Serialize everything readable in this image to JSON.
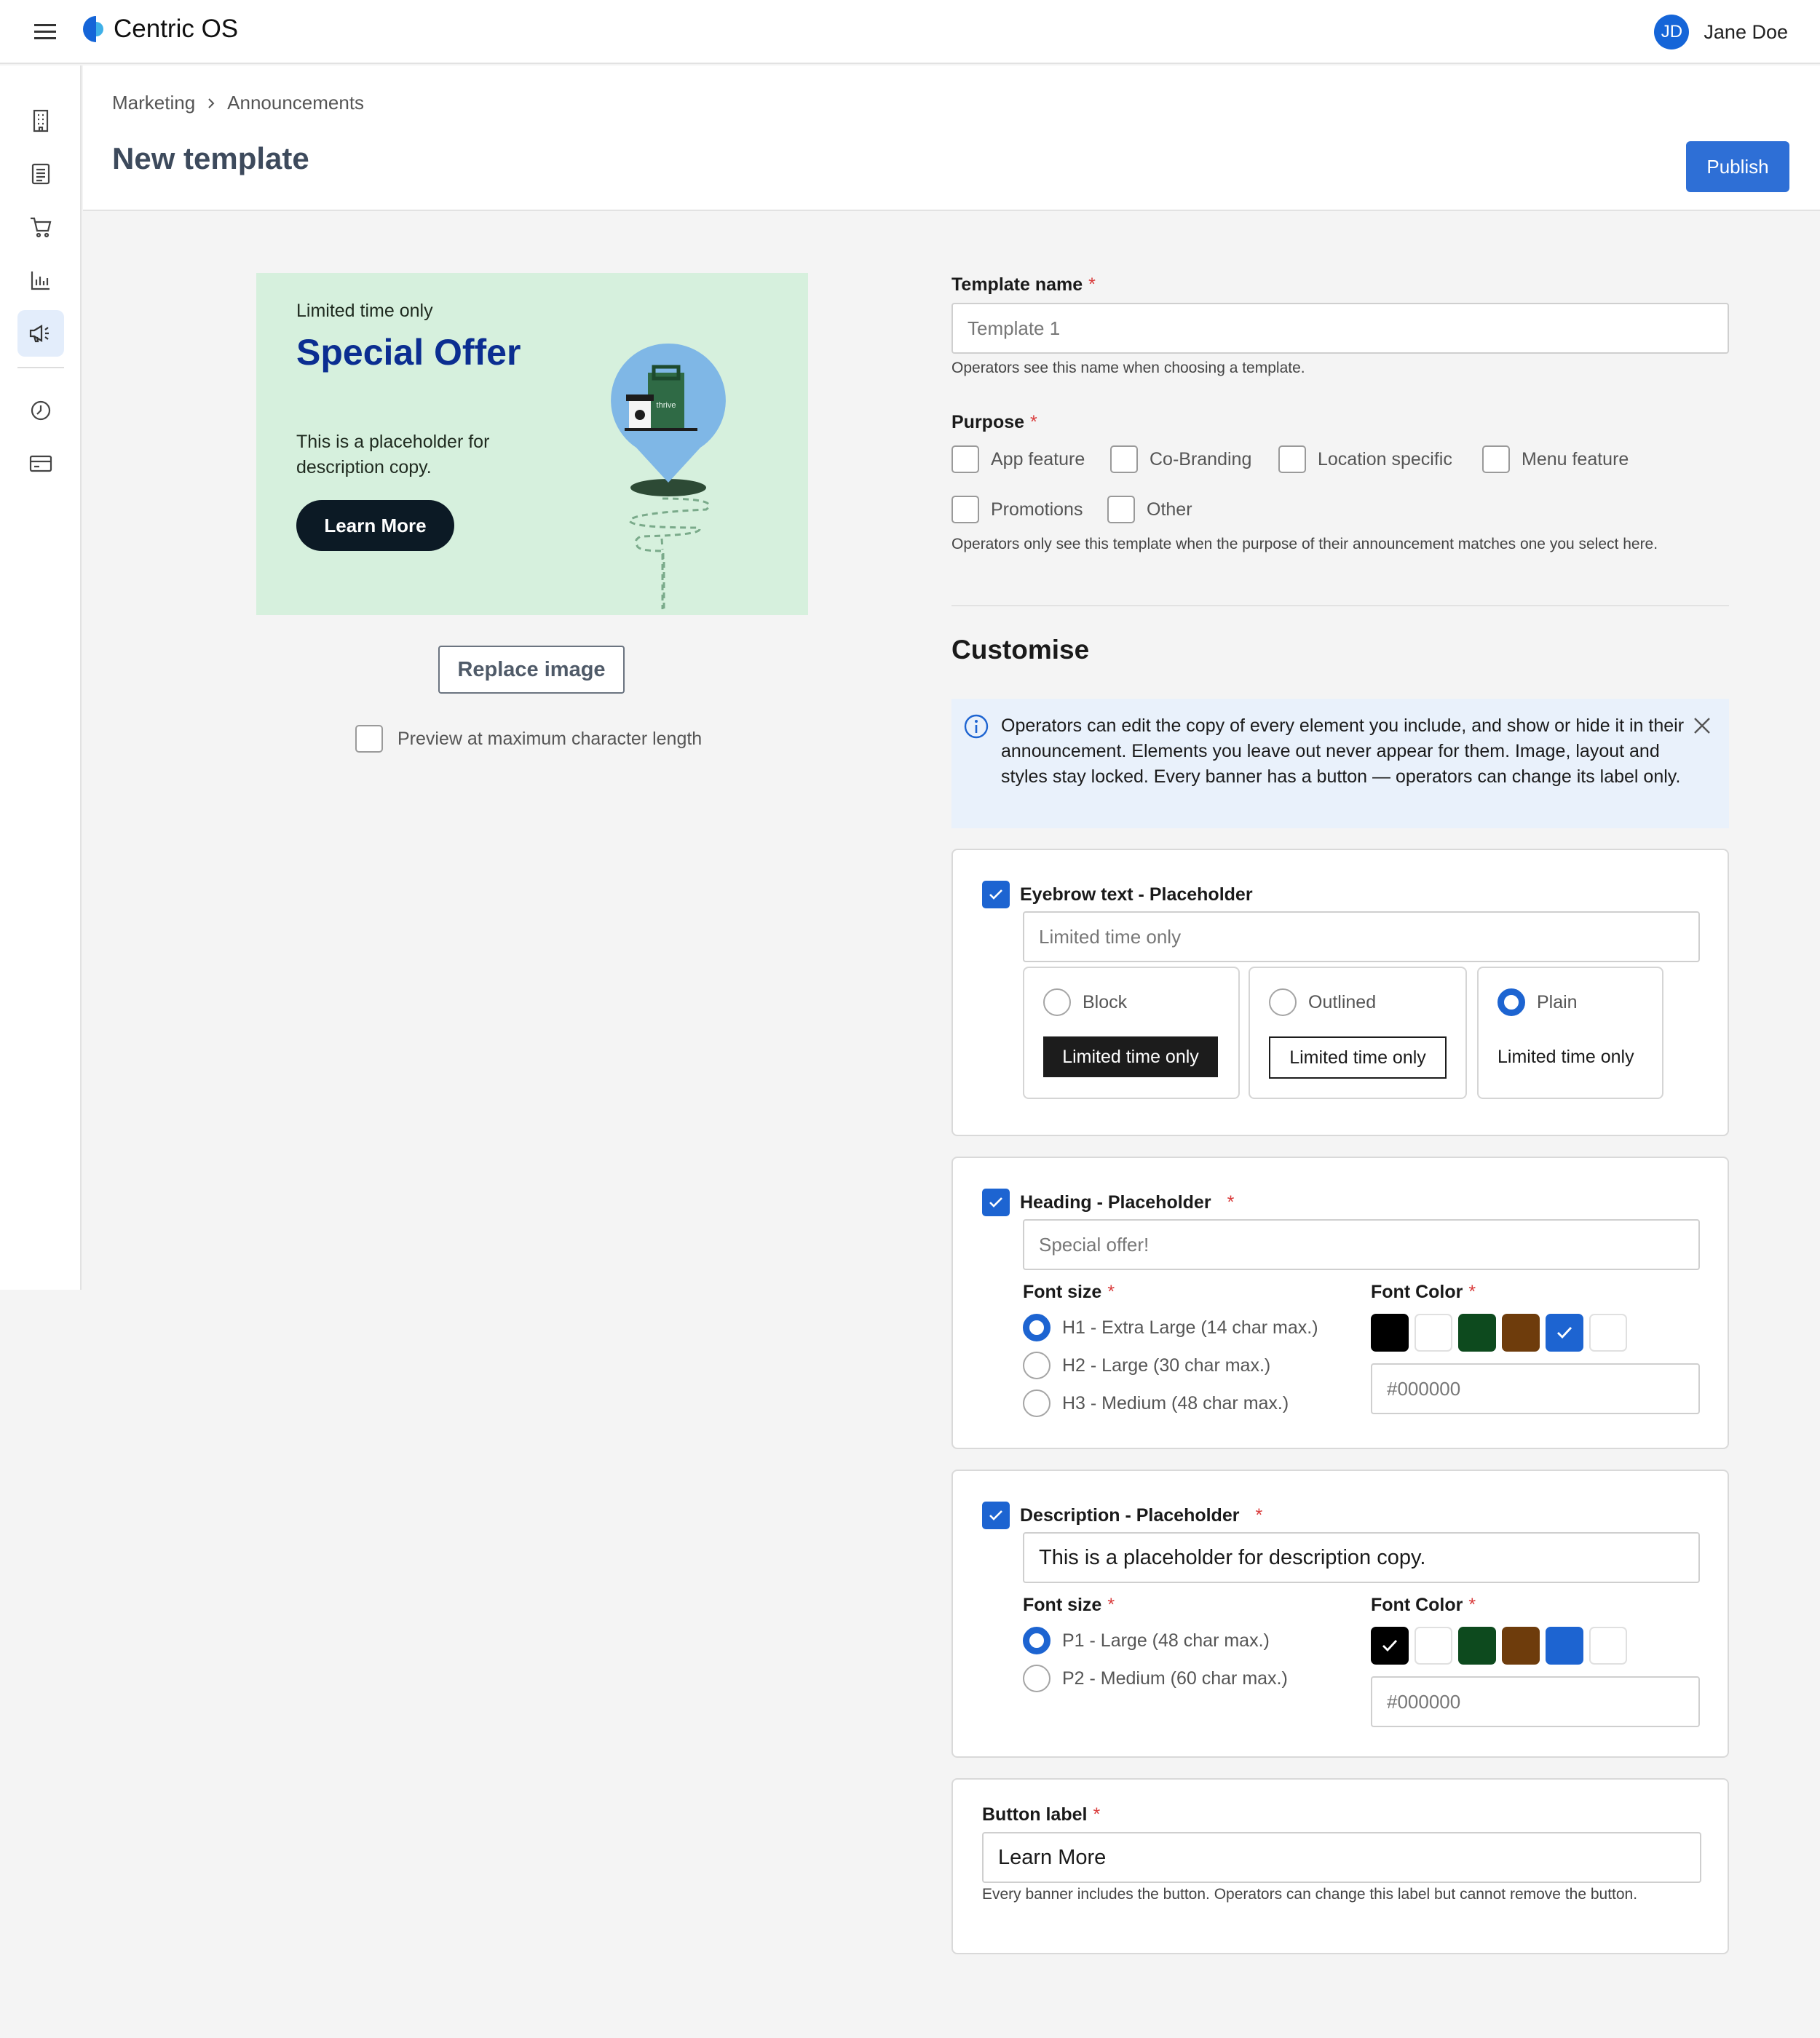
{
  "app": {
    "name": "Centric OS"
  },
  "user": {
    "initials": "JD",
    "name": "Jane Doe"
  },
  "breadcrumb": [
    "Marketing",
    "Announcements"
  ],
  "page": {
    "title": "New template",
    "publish_label": "Publish"
  },
  "preview": {
    "eyebrow": "Limited time only",
    "heading": "Special Offer",
    "description": "This is a placeholder for description copy.",
    "button": "Learn More",
    "art_label": "thrive",
    "replace_label": "Replace image",
    "max_length_label": "Preview at maximum character length",
    "bg_color": "#d6f0dd",
    "heading_color": "#0b2e91"
  },
  "form": {
    "template_name": {
      "label": "Template name",
      "placeholder": "Template 1",
      "help": "Operators see this name when choosing a template."
    },
    "purpose": {
      "label": "Purpose",
      "options": [
        "App feature",
        "Co-Branding",
        "Location specific",
        "Menu feature",
        "Promotions",
        "Other"
      ],
      "help": "Operators only see this template when the purpose of their announcement matches one you select here."
    },
    "customise_title": "Customise",
    "info": "Operators can edit the copy of every element you include, and show or hide it in their announcement. Elements you leave out never appear for them. Image, layout and styles stay locked. Every banner has a button — operators can change its label only.",
    "eyebrow": {
      "label": "Eyebrow text - Placeholder",
      "placeholder": "Limited time only",
      "styles": [
        {
          "name": "Block",
          "sample": "Limited time only"
        },
        {
          "name": "Outlined",
          "sample": "Limited time only"
        },
        {
          "name": "Plain",
          "sample": "Limited time only",
          "selected": true
        }
      ]
    },
    "heading": {
      "label": "Heading - Placeholder",
      "placeholder": "Special offer!",
      "font_size_label": "Font size",
      "sizes": [
        "H1 - Extra Large (14 char max.)",
        "H2 - Large (30 char max.)",
        "H3 - Medium (48 char max.)"
      ],
      "font_color_label": "Font Color",
      "color_value": "#000000"
    },
    "description": {
      "label": "Description - Placeholder",
      "value": "This is a placeholder for description copy.",
      "font_size_label": "Font size",
      "sizes": [
        "P1 - Large (48 char max.)",
        "P2 - Medium (60 char max.)"
      ],
      "font_color_label": "Font Color",
      "color_value": "#000000"
    },
    "button_label": {
      "label": "Button label",
      "value": "Learn More",
      "help": "Every banner includes the button. Operators can change this label but cannot remove the button."
    }
  },
  "colors": {
    "accent": "#1d64d1",
    "swatches": [
      "#000000",
      "#ffffff",
      "#0d4a1e",
      "#6e3c0c",
      "#1d64d1",
      "#ffffff"
    ]
  }
}
